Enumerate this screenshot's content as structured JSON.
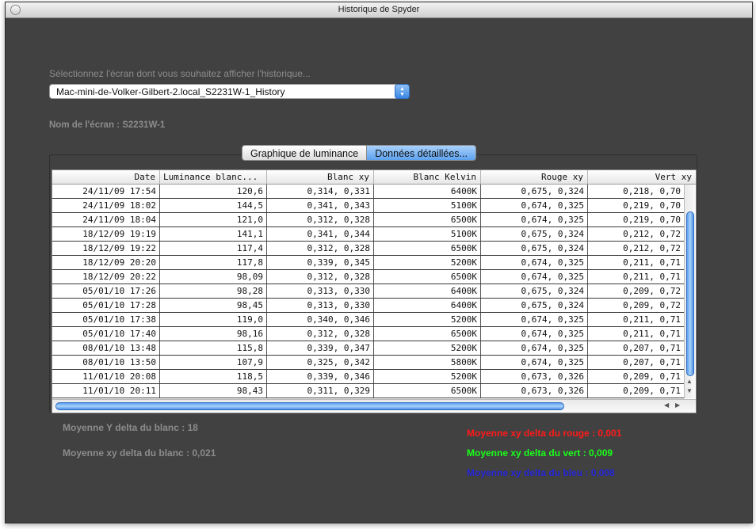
{
  "window": {
    "title": "Historique de Spyder"
  },
  "prompt": "Sélectionnez l'écran dont vous souhaitez afficher l'historique...",
  "history_select": {
    "value": "Mac-mini-de-Volker-Gilbert-2.local_S2231W-1_History"
  },
  "screen_name": "Nom de l'écran : S2231W-1",
  "tabs": [
    {
      "label": "Graphique de luminance",
      "selected": false
    },
    {
      "label": "Données détaillées...",
      "selected": true
    }
  ],
  "table": {
    "columns": [
      "Date",
      "Luminance blanc...",
      "Blanc xy",
      "Blanc Kelvin",
      "Rouge xy",
      "Vert xy"
    ],
    "rows": [
      [
        "24/11/09 17:54",
        "120,6",
        "0,314, 0,331",
        "6400K",
        "0,675, 0,324",
        "0,218, 0,70"
      ],
      [
        "24/11/09 18:02",
        "144,5",
        "0,341, 0,343",
        "5100K",
        "0,674, 0,325",
        "0,219, 0,70"
      ],
      [
        "24/11/09 18:04",
        "121,0",
        "0,312, 0,328",
        "6500K",
        "0,674, 0,325",
        "0,219, 0,70"
      ],
      [
        "18/12/09 19:19",
        "141,1",
        "0,341, 0,344",
        "5100K",
        "0,675, 0,324",
        "0,212, 0,72"
      ],
      [
        "18/12/09 19:22",
        "117,4",
        "0,312, 0,328",
        "6500K",
        "0,675, 0,324",
        "0,212, 0,72"
      ],
      [
        "18/12/09 20:20",
        "117,8",
        "0,339, 0,345",
        "5200K",
        "0,674, 0,325",
        "0,211, 0,71"
      ],
      [
        "18/12/09 20:22",
        "98,09",
        "0,312, 0,328",
        "6500K",
        "0,674, 0,325",
        "0,211, 0,71"
      ],
      [
        "05/01/10 17:26",
        "98,28",
        "0,313, 0,330",
        "6400K",
        "0,675, 0,324",
        "0,209, 0,72"
      ],
      [
        "05/01/10 17:28",
        "98,45",
        "0,313, 0,330",
        "6400K",
        "0,675, 0,324",
        "0,209, 0,72"
      ],
      [
        "05/01/10 17:38",
        "119,0",
        "0,340, 0,346",
        "5200K",
        "0,674, 0,325",
        "0,211, 0,71"
      ],
      [
        "05/01/10 17:40",
        "98,16",
        "0,312, 0,328",
        "6500K",
        "0,674, 0,325",
        "0,211, 0,71"
      ],
      [
        "08/01/10 13:48",
        "115,8",
        "0,339, 0,347",
        "5200K",
        "0,674, 0,325",
        "0,207, 0,71"
      ],
      [
        "08/01/10 13:50",
        "107,9",
        "0,325, 0,342",
        "5800K",
        "0,674, 0,325",
        "0,207, 0,71"
      ],
      [
        "11/01/10 20:08",
        "118,5",
        "0,339, 0,346",
        "5200K",
        "0,673, 0,326",
        "0,209, 0,71"
      ],
      [
        "11/01/10 20:11",
        "98,43",
        "0,311, 0,329",
        "6500K",
        "0,673, 0,326",
        "0,209, 0,71"
      ]
    ]
  },
  "stats": {
    "y_delta_white": "Moyenne Y delta du blanc : 18",
    "xy_delta_white": "Moyenne xy delta du blanc : 0,021",
    "xy_delta_red": "Moyenne xy delta du rouge : 0,001",
    "xy_delta_green": "Moyenne xy delta du vert : 0,009",
    "xy_delta_blue": "Moyenne xy delta du bleu : 0,008"
  },
  "colors": {
    "red": "#ff1a1a",
    "green": "#1aff1a",
    "blue": "#2424d8",
    "accent": "#5da2ef"
  },
  "icons": {
    "popup": "up-down-arrows-icon",
    "close": "close-button-icon"
  }
}
